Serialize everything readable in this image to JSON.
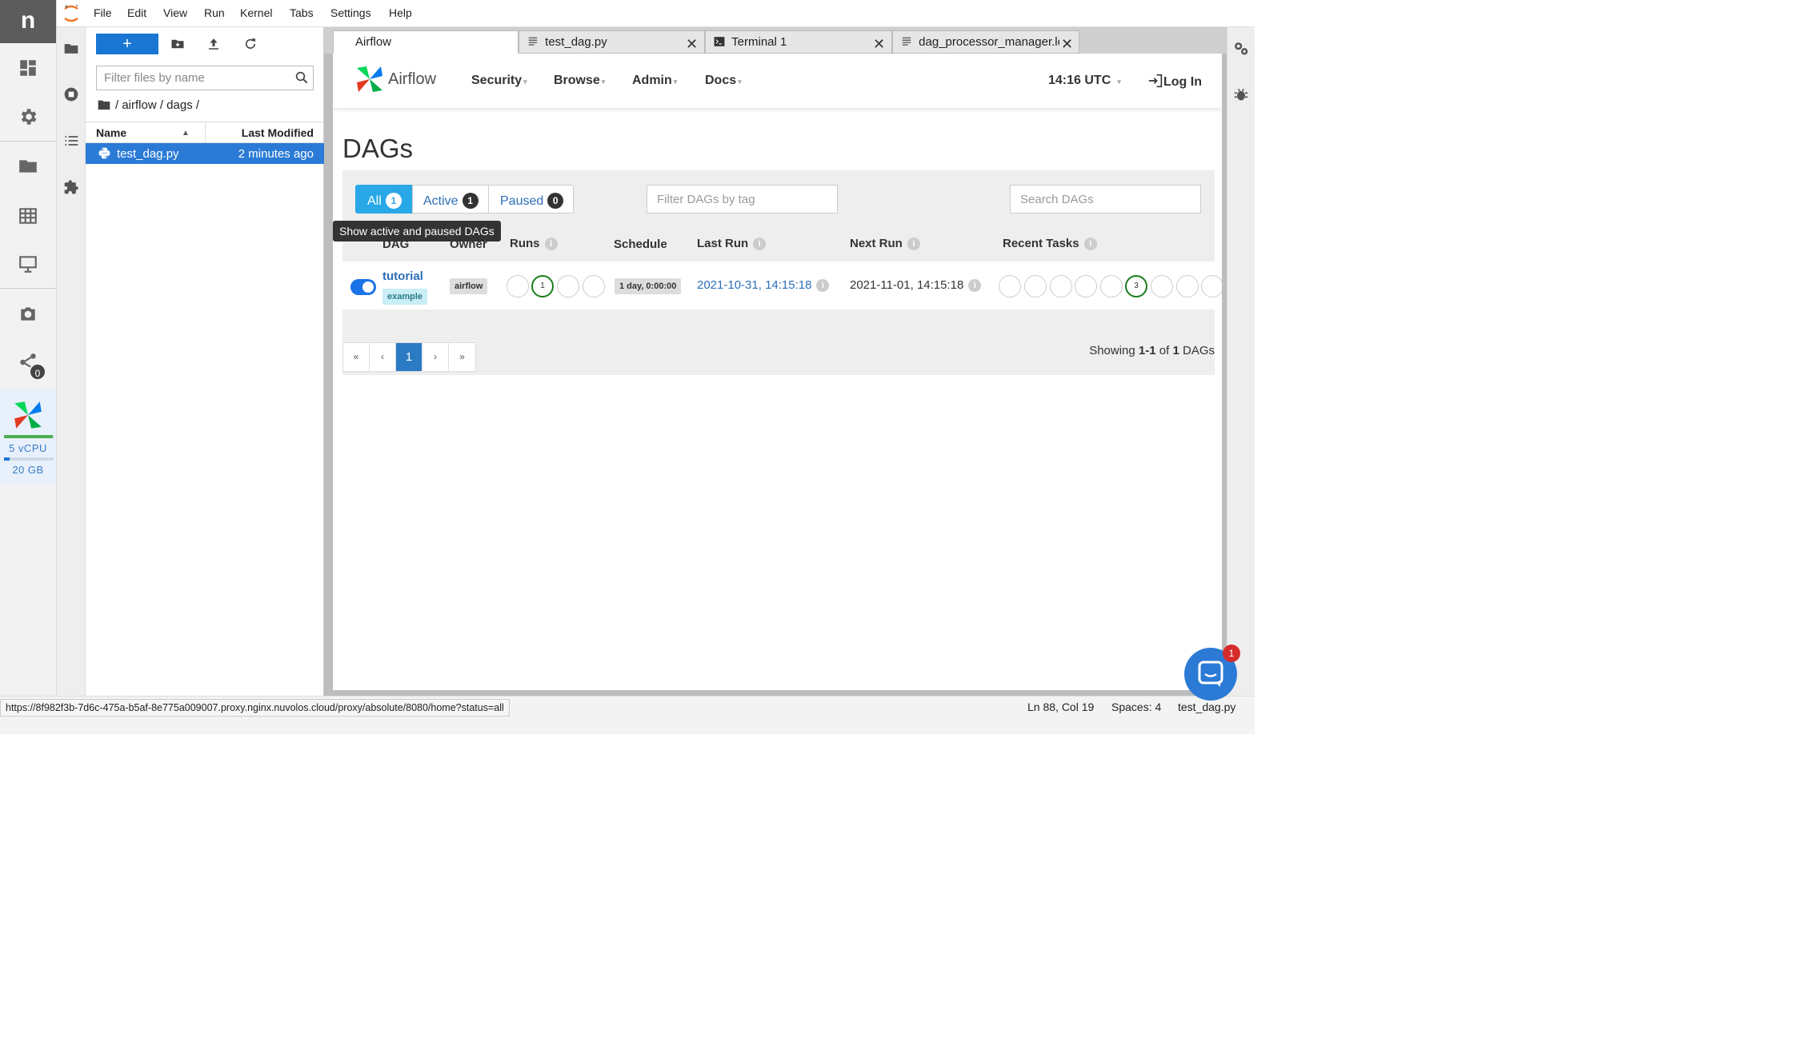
{
  "rail": {
    "logo": "n",
    "share_count": "0",
    "resources": {
      "cpu": "5 vCPU",
      "mem": "20 GB",
      "cpu_fraction": 0.98,
      "mem_fraction": 0.12,
      "accent": "#4caf50"
    }
  },
  "menu": [
    "File",
    "Edit",
    "View",
    "Run",
    "Kernel",
    "Tabs",
    "Settings",
    "Help"
  ],
  "filebrowser": {
    "new_label": "+",
    "filter_placeholder": "Filter files by name",
    "breadcrumb": "/ airflow / dags /",
    "col_name": "Name",
    "col_modified": "Last Modified",
    "files": [
      {
        "name": "test_dag.py",
        "modified": "2 minutes ago"
      }
    ]
  },
  "tabs": [
    {
      "label": "Airflow"
    },
    {
      "label": "test_dag.py"
    },
    {
      "label": "Terminal 1"
    },
    {
      "label": "dag_processor_manager.lo"
    }
  ],
  "airflow": {
    "brand": "Airflow",
    "nav": [
      "Security",
      "Browse",
      "Admin",
      "Docs"
    ],
    "time": "14:16 UTC",
    "login": "Log In",
    "page_title": "DAGs",
    "filters": {
      "all": {
        "label": "All",
        "count": "1"
      },
      "active": {
        "label": "Active",
        "count": "1"
      },
      "paused": {
        "label": "Paused",
        "count": "0"
      }
    },
    "tag_placeholder": "Filter DAGs by tag",
    "search_placeholder": "Search DAGs",
    "tooltip": "Show active and paused DAGs",
    "columns": {
      "dag": "DAG",
      "owner": "Owner",
      "runs": "Runs",
      "schedule": "Schedule",
      "last_run": "Last Run",
      "next_run": "Next Run",
      "recent": "Recent Tasks"
    },
    "dag": {
      "name": "tutorial",
      "tag": "example",
      "owner": "airflow",
      "runs": [
        "",
        "1",
        "",
        ""
      ],
      "schedule": "1 day, 0:00:00",
      "last_run": "2021-10-31, 14:15:18",
      "next_run": "2021-11-01, 14:15:18",
      "recent": [
        "",
        "",
        "",
        "",
        "",
        "3",
        "",
        "",
        ""
      ],
      "success_color": "#1a7e1a",
      "toggle_on": true
    },
    "pager": {
      "first": "«",
      "prev": "‹",
      "current": "1",
      "next": "›",
      "last": "»"
    },
    "showing": {
      "prefix": "Showing ",
      "range": "1-1",
      "of": " of ",
      "total": "1",
      "suffix": " DAGs"
    }
  },
  "status": {
    "url": "https://8f982f3b-7d6c-475a-b5af-8e775a009007.proxy.nginx.nuvolos.cloud/proxy/absolute/8080/home?status=all",
    "position": "Ln 88, Col 19",
    "spaces": "Spaces: 4",
    "file": "test_dag.py"
  },
  "chat": {
    "badge": "1"
  },
  "icons": [
    "dashboard-icon",
    "gear-icon",
    "folder-icon",
    "table-icon",
    "monitor-icon",
    "camera-icon",
    "share-icon",
    "airflow-logo-icon",
    "jupyter-logo-icon",
    "new-folder-icon",
    "upload-icon",
    "refresh-icon",
    "search-icon",
    "python-file-icon",
    "stop-icon",
    "list-icon",
    "puzzle-icon",
    "text-file-icon",
    "terminal-icon",
    "close-icon",
    "property-inspector-icon",
    "debugger-icon",
    "login-icon",
    "chat-icon"
  ]
}
